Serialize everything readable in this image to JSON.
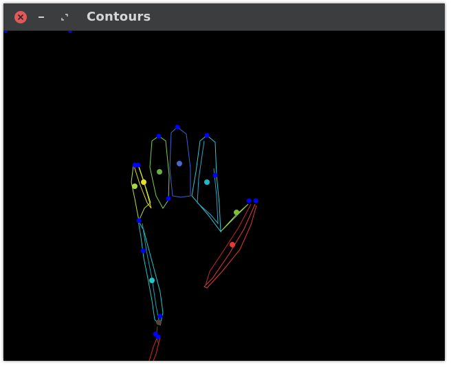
{
  "window": {
    "title": "Contours"
  },
  "colors": {
    "titlebar": "#3b3d3f",
    "close": "#e0595d",
    "canvas": "#000000",
    "point": "#0000ff"
  },
  "icons": {
    "close": "close-icon",
    "minimize": "minimize-icon",
    "maximize": "maximize-icon"
  }
}
